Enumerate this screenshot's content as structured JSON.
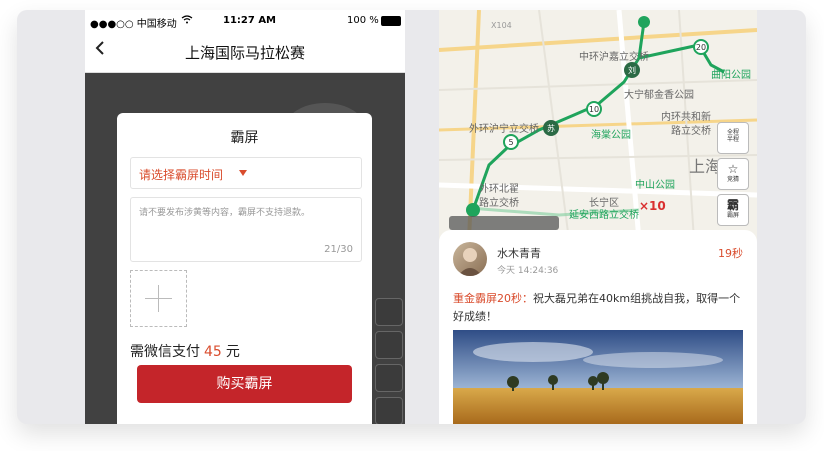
{
  "left": {
    "statusbar": {
      "carrier": "●●●○○ 中国移动",
      "time": "11:27 AM",
      "battery": "100 %"
    },
    "nav": {
      "back_icon": "chevron-left-icon",
      "title": "上海国际马拉松赛"
    },
    "modal": {
      "title": "霸屏",
      "time_select_placeholder": "请选择霸屏时间",
      "message_placeholder": "请不要发布涉黄等内容，霸屏不支持退款。",
      "char_count": "21/30",
      "upload_icon": "plus-icon",
      "pay_prefix": "需微信支付",
      "pay_amount": "45",
      "pay_unit": "元",
      "buy_label": "购买霸屏"
    }
  },
  "right": {
    "map": {
      "labels": [
        "X104",
        "中环沪嘉立交桥",
        "大宁郁金香公园",
        "曲阳公园",
        "外环沪宁立交桥",
        "海棠公园",
        "内环共和新",
        "路立交桥",
        "上海",
        "中山公园",
        "外环北翟",
        "路立交桥",
        "长宁区",
        "延安西路立交桥"
      ],
      "km_markers": [
        "5",
        "10",
        "20"
      ],
      "node_labels": [
        "苏",
        "刘"
      ],
      "multiplier": "×10",
      "route_color": "#1fa45c",
      "buttons": [
        {
          "icon": "map-icon",
          "label1": "全程",
          "label2": "半程"
        },
        {
          "icon": "star-icon",
          "label1": "☆",
          "label2": "竞猜"
        },
        {
          "icon": "screen-icon",
          "label1": "霸",
          "label2": "霸屏"
        }
      ]
    },
    "post": {
      "username": "水木青青",
      "time": "今天 14:24:36",
      "duration": "19秒",
      "tag": "重金霸屏20秒：",
      "message": "祝大磊兄弟在40km组挑战自我，取得一个好成绩！"
    }
  },
  "colors": {
    "accent_red": "#c4252a",
    "text_red": "#d94c2d",
    "route_green": "#1fa45c"
  }
}
